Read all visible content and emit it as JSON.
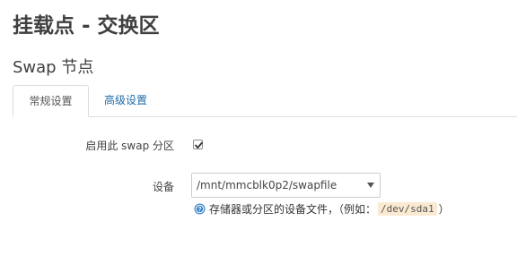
{
  "page": {
    "title": "挂载点 - 交换区"
  },
  "section": {
    "title": "Swap 节点"
  },
  "tabs": [
    {
      "label": "常规设置",
      "active": true
    },
    {
      "label": "高级设置",
      "active": false
    }
  ],
  "form": {
    "enable": {
      "label": "启用此 swap 分区",
      "checked": true
    },
    "device": {
      "label": "设备",
      "selected": "/mnt/mmcblk0p2/swapfile",
      "hint_text": "存储器或分区的设备文件，（例如：",
      "hint_code": "/dev/sda1",
      "hint_close": "）",
      "hint_icon": "info-icon"
    }
  },
  "colors": {
    "link": "#1f6da8",
    "code_bg": "#fbead2",
    "info_icon": "#3a87c9"
  }
}
